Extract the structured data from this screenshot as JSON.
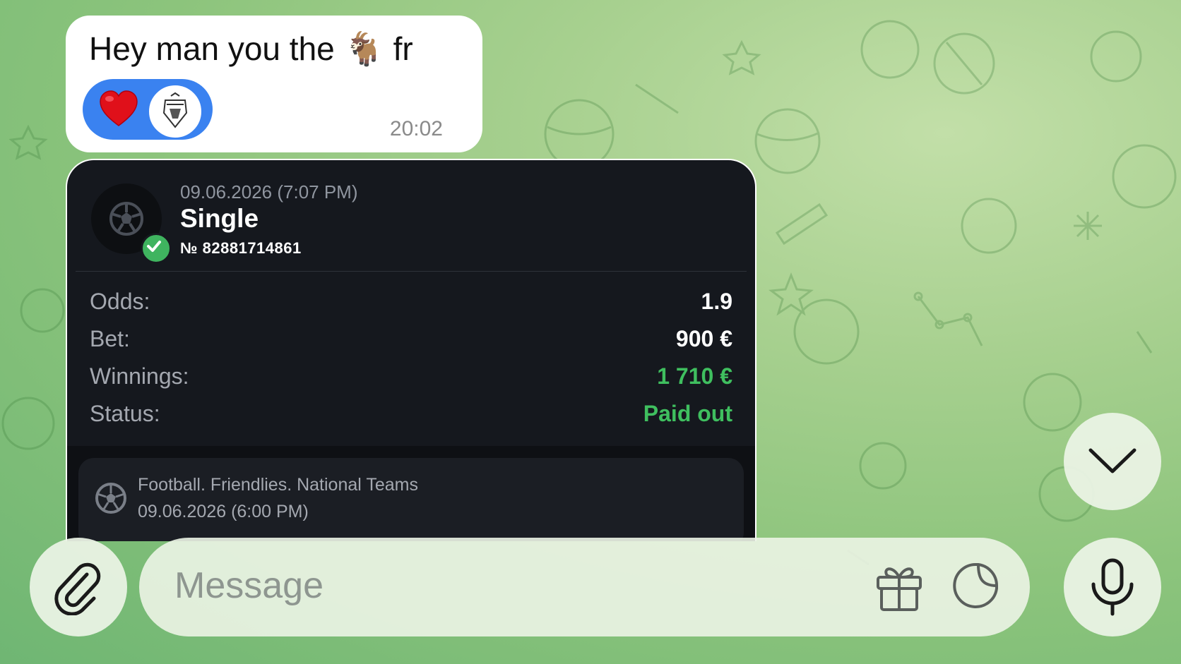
{
  "chat": {
    "message": {
      "text": "Hey man you the 🐐 fr",
      "time": "20:02",
      "reactions": [
        {
          "icon": "red-heart",
          "color": "#e0101a"
        },
        {
          "icon": "club-badge-avatar"
        }
      ]
    }
  },
  "bet": {
    "date": "09.06.2026 (7:07 PM)",
    "type": "Single",
    "number": "№ 82881714861",
    "rows": [
      {
        "label": "Odds:",
        "value": "1.9"
      },
      {
        "label": "Bet:",
        "value": "900 €"
      },
      {
        "label": "Winnings:",
        "value": "1 710 €"
      },
      {
        "label": "Status:",
        "value": "Paid out"
      }
    ],
    "event": {
      "title": "Football. Friendlies. National Teams",
      "date": "09.06.2026 (6:00 PM)"
    },
    "colors": {
      "accent_green": "#3fbf5f",
      "card_bg": "#15181e"
    }
  },
  "composer": {
    "placeholder": "Message",
    "icons": [
      "paperclip-icon",
      "gift-icon",
      "sticker-icon",
      "microphone-icon",
      "scroll-down-icon"
    ]
  },
  "theme": {
    "chat_bubble": "#ffffff",
    "reaction_bg": "#3a82f0"
  }
}
